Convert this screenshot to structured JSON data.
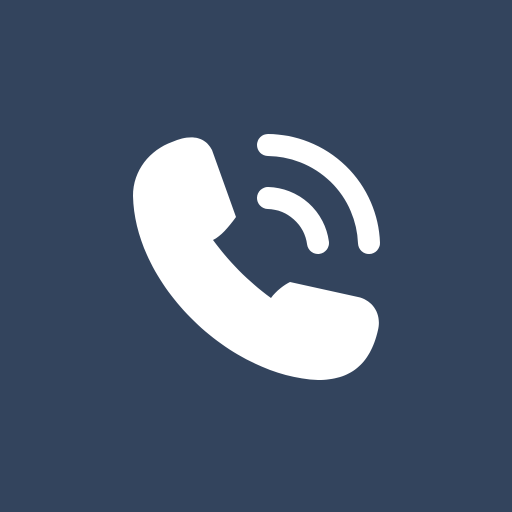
{
  "app_icon": {
    "icon_name": "phone-call-icon",
    "background_color": "#33445d",
    "glyph_color": "#ffffff"
  }
}
